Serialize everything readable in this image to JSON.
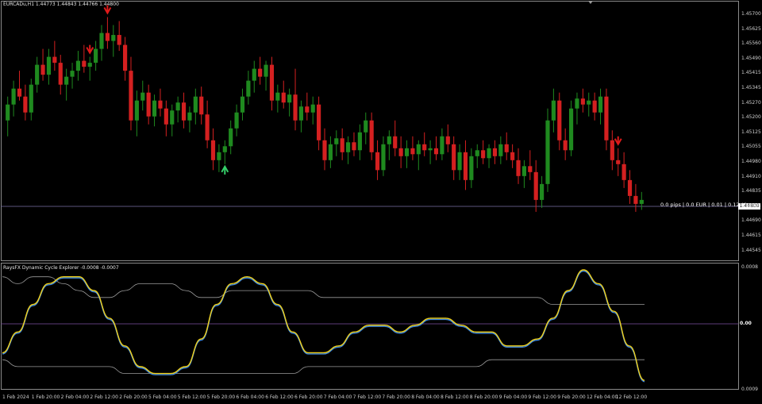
{
  "header": {
    "symbol_title": "EURCADu,H1  1.44773 1.44843 1.44766 1.44800",
    "indicator_title": "RaysFX Dynamic Cycle Explorer -0.0008 -0.0007"
  },
  "overlay": {
    "pips_label": "0.0 pips | 0.0 EUR | 0.01 | 0.12 / |",
    "current_price": "1.44800",
    "indicator_zero": "0.00"
  },
  "price_axis": [
    "1.45700",
    "1.45625",
    "1.45560",
    "1.45490",
    "1.45415",
    "1.45345",
    "1.45270",
    "1.45200",
    "1.45125",
    "1.45055",
    "1.44980",
    "1.44910",
    "1.44835",
    "1.44765",
    "1.44690",
    "1.44615",
    "1.44545"
  ],
  "indicator_axis": [
    "0.0008",
    "0.00",
    "0.0009"
  ],
  "time_axis": [
    "1 Feb 2024",
    "1 Feb 20:00",
    "2 Feb 04:00",
    "2 Feb 12:00",
    "2 Feb 20:00",
    "5 Feb 04:00",
    "5 Feb 12:00",
    "5 Feb 20:00",
    "6 Feb 04:00",
    "6 Feb 12:00",
    "6 Feb 20:00",
    "7 Feb 04:00",
    "7 Feb 12:00",
    "7 Feb 20:00",
    "8 Feb 04:00",
    "8 Feb 12:00",
    "8 Feb 20:00",
    "9 Feb 04:00",
    "9 Feb 12:00",
    "9 Feb 20:00",
    "12 Feb 04:00",
    "12 Feb 12:00"
  ],
  "colors": {
    "bull": "#1f8a1f",
    "bear": "#d42020",
    "signal_down": "#e01a1a",
    "signal_up": "#35d06a",
    "cycle_fast": "#f2d21b",
    "cycle_slow": "#3a86e0",
    "bands": "#9a9a9a",
    "zero_line": "#7a4fa0",
    "price_line": "#7b6fa8"
  },
  "chart_data": {
    "type": "candlestick",
    "symbol": "EURCADu",
    "timeframe": "H1",
    "last_price": 1.448,
    "y_range": [
      1.4452,
      1.4575
    ],
    "candles": [
      [
        1.452,
        1.4532,
        1.4512,
        1.4528
      ],
      [
        1.4528,
        1.454,
        1.4522,
        1.4536
      ],
      [
        1.4536,
        1.4545,
        1.453,
        1.4532
      ],
      [
        1.4532,
        1.4538,
        1.452,
        1.4524
      ],
      [
        1.4524,
        1.4541,
        1.452,
        1.4538
      ],
      [
        1.4538,
        1.4552,
        1.4534,
        1.4548
      ],
      [
        1.4548,
        1.4556,
        1.454,
        1.4543
      ],
      [
        1.4543,
        1.4556,
        1.4538,
        1.4552
      ],
      [
        1.4552,
        1.456,
        1.4545,
        1.4549
      ],
      [
        1.4549,
        1.4553,
        1.4533,
        1.4538
      ],
      [
        1.4538,
        1.4546,
        1.453,
        1.4542
      ],
      [
        1.4542,
        1.4549,
        1.4536,
        1.4545
      ],
      [
        1.4545,
        1.4555,
        1.454,
        1.455
      ],
      [
        1.455,
        1.4558,
        1.4544,
        1.4547
      ],
      [
        1.4547,
        1.4552,
        1.454,
        1.4549
      ],
      [
        1.4549,
        1.456,
        1.4545,
        1.4556
      ],
      [
        1.4556,
        1.4568,
        1.455,
        1.4564
      ],
      [
        1.4564,
        1.4572,
        1.4556,
        1.456
      ],
      [
        1.456,
        1.4568,
        1.4552,
        1.4563
      ],
      [
        1.4563,
        1.457,
        1.4555,
        1.4558
      ],
      [
        1.4558,
        1.4562,
        1.454,
        1.4545
      ],
      [
        1.4545,
        1.4552,
        1.4515,
        1.452
      ],
      [
        1.452,
        1.4535,
        1.4512,
        1.453
      ],
      [
        1.453,
        1.454,
        1.4525,
        1.4534
      ],
      [
        1.4534,
        1.4538,
        1.4518,
        1.4522
      ],
      [
        1.4522,
        1.4533,
        1.4517,
        1.453
      ],
      [
        1.453,
        1.4536,
        1.4522,
        1.4526
      ],
      [
        1.4526,
        1.453,
        1.4512,
        1.4518
      ],
      [
        1.4518,
        1.4528,
        1.4512,
        1.4525
      ],
      [
        1.4525,
        1.4532,
        1.4519,
        1.4529
      ],
      [
        1.4529,
        1.4534,
        1.4516,
        1.452
      ],
      [
        1.452,
        1.4527,
        1.4514,
        1.4524
      ],
      [
        1.4524,
        1.4536,
        1.4518,
        1.4532
      ],
      [
        1.4532,
        1.4537,
        1.4518,
        1.4523
      ],
      [
        1.4523,
        1.453,
        1.4506,
        1.451
      ],
      [
        1.451,
        1.4516,
        1.4495,
        1.45
      ],
      [
        1.45,
        1.4508,
        1.4494,
        1.4504
      ],
      [
        1.4504,
        1.451,
        1.4498,
        1.4507
      ],
      [
        1.4507,
        1.452,
        1.4503,
        1.4516
      ],
      [
        1.4516,
        1.4528,
        1.4512,
        1.4524
      ],
      [
        1.4524,
        1.4536,
        1.452,
        1.4532
      ],
      [
        1.4532,
        1.4545,
        1.4528,
        1.454
      ],
      [
        1.454,
        1.455,
        1.4534,
        1.4546
      ],
      [
        1.4546,
        1.4552,
        1.4538,
        1.4542
      ],
      [
        1.4542,
        1.455,
        1.4535,
        1.4548
      ],
      [
        1.4548,
        1.4552,
        1.4525,
        1.453
      ],
      [
        1.453,
        1.4538,
        1.4524,
        1.4534
      ],
      [
        1.4534,
        1.454,
        1.4526,
        1.4529
      ],
      [
        1.4529,
        1.4536,
        1.4522,
        1.4533
      ],
      [
        1.4533,
        1.4546,
        1.4515,
        1.452
      ],
      [
        1.452,
        1.453,
        1.4514,
        1.4527
      ],
      [
        1.4527,
        1.4534,
        1.452,
        1.4524
      ],
      [
        1.4524,
        1.4532,
        1.4518,
        1.4528
      ],
      [
        1.4528,
        1.4532,
        1.4505,
        1.451
      ],
      [
        1.451,
        1.4516,
        1.4495,
        1.45
      ],
      [
        1.45,
        1.4512,
        1.4496,
        1.4508
      ],
      [
        1.4508,
        1.4515,
        1.4502,
        1.4511
      ],
      [
        1.4511,
        1.4516,
        1.45,
        1.4504
      ],
      [
        1.4504,
        1.4512,
        1.4498,
        1.4509
      ],
      [
        1.4509,
        1.4514,
        1.4502,
        1.4505
      ],
      [
        1.4505,
        1.4518,
        1.45,
        1.4514
      ],
      [
        1.4514,
        1.4524,
        1.4508,
        1.452
      ],
      [
        1.452,
        1.4524,
        1.45,
        1.4504
      ],
      [
        1.4504,
        1.451,
        1.449,
        1.4495
      ],
      [
        1.4495,
        1.4512,
        1.4492,
        1.4508
      ],
      [
        1.4508,
        1.4515,
        1.45,
        1.4512
      ],
      [
        1.4512,
        1.452,
        1.4502,
        1.4506
      ],
      [
        1.4506,
        1.4512,
        1.4496,
        1.4502
      ],
      [
        1.4502,
        1.451,
        1.4496,
        1.4506
      ],
      [
        1.4506,
        1.4512,
        1.45,
        1.4503
      ],
      [
        1.4503,
        1.451,
        1.4495,
        1.4508
      ],
      [
        1.4508,
        1.4514,
        1.4502,
        1.4505
      ],
      [
        1.4505,
        1.451,
        1.4498,
        1.4506
      ],
      [
        1.4506,
        1.4512,
        1.45,
        1.4503
      ],
      [
        1.4503,
        1.4516,
        1.45,
        1.4512
      ],
      [
        1.4512,
        1.4518,
        1.4504,
        1.4508
      ],
      [
        1.4508,
        1.4512,
        1.449,
        1.4495
      ],
      [
        1.4495,
        1.4508,
        1.449,
        1.4504
      ],
      [
        1.4504,
        1.451,
        1.4485,
        1.449
      ],
      [
        1.449,
        1.4506,
        1.4486,
        1.4502
      ],
      [
        1.4502,
        1.4508,
        1.4496,
        1.4505
      ],
      [
        1.4505,
        1.451,
        1.4498,
        1.4501
      ],
      [
        1.4501,
        1.4508,
        1.4496,
        1.4506
      ],
      [
        1.4506,
        1.451,
        1.4498,
        1.4502
      ],
      [
        1.4502,
        1.4512,
        1.4498,
        1.4508
      ],
      [
        1.4508,
        1.4514,
        1.45,
        1.4504
      ],
      [
        1.4504,
        1.4508,
        1.4496,
        1.45
      ],
      [
        1.45,
        1.4506,
        1.4488,
        1.4492
      ],
      [
        1.4492,
        1.45,
        1.4486,
        1.4497
      ],
      [
        1.4497,
        1.4505,
        1.449,
        1.4494
      ],
      [
        1.4494,
        1.45,
        1.4474,
        1.448
      ],
      [
        1.448,
        1.4492,
        1.4476,
        1.4488
      ],
      [
        1.4488,
        1.4526,
        1.4484,
        1.452
      ],
      [
        1.452,
        1.4536,
        1.4514,
        1.453
      ],
      [
        1.453,
        1.4534,
        1.4505,
        1.451
      ],
      [
        1.451,
        1.4516,
        1.45,
        1.4505
      ],
      [
        1.4505,
        1.453,
        1.4502,
        1.4526
      ],
      [
        1.4526,
        1.4534,
        1.4518,
        1.4531
      ],
      [
        1.4531,
        1.4536,
        1.4524,
        1.4528
      ],
      [
        1.4528,
        1.4534,
        1.4522,
        1.453
      ],
      [
        1.453,
        1.4534,
        1.452,
        1.4524
      ],
      [
        1.4524,
        1.4536,
        1.4518,
        1.4532
      ],
      [
        1.4532,
        1.4536,
        1.4505,
        1.451
      ],
      [
        1.451,
        1.4515,
        1.4495,
        1.45
      ],
      [
        1.45,
        1.4506,
        1.4492,
        1.4498
      ],
      [
        1.4498,
        1.4504,
        1.4486,
        1.449
      ],
      [
        1.449,
        1.4495,
        1.4478,
        1.4482
      ],
      [
        1.4482,
        1.4488,
        1.4474,
        1.4478
      ],
      [
        1.4478,
        1.4484,
        1.4475,
        1.448
      ]
    ],
    "signal_arrows": [
      {
        "bar": 17,
        "direction": "down"
      },
      {
        "bar": 14,
        "direction": "down"
      },
      {
        "bar": 37,
        "direction": "up"
      },
      {
        "bar": 104,
        "direction": "down"
      }
    ],
    "indicator": {
      "name": "RaysFX Dynamic Cycle Explorer",
      "values": [
        -0.0008,
        -0.0007
      ],
      "y_range": [
        -0.0009,
        0.0008
      ],
      "cycle_series": [
        -0.0004,
        -0.0001,
        0.0003,
        0.0006,
        0.0007,
        0.0007,
        0.0005,
        0.0001,
        -0.0003,
        -0.0006,
        -0.0007,
        -0.0007,
        -0.0006,
        -0.0002,
        0.0003,
        0.0006,
        0.0007,
        0.0006,
        0.0003,
        -0.0001,
        -0.0004,
        -0.0004,
        -0.0003,
        -0.0001,
        0.0,
        0.0,
        -0.0001,
        0.0,
        0.0001,
        0.0001,
        0.0,
        -0.0001,
        -0.0001,
        -0.0003,
        -0.0003,
        -0.0002,
        0.0001,
        0.0005,
        0.0008,
        0.0006,
        0.0002,
        -0.0003,
        -0.0008
      ],
      "upper_band": [
        0.0007,
        0.0006,
        0.0007,
        0.0007,
        0.0006,
        0.0005,
        0.0004,
        0.0004,
        0.0005,
        0.0006,
        0.0006,
        0.0006,
        0.0005,
        0.0004,
        0.0004,
        0.0005,
        0.0005,
        0.0005,
        0.0005,
        0.0005,
        0.0005,
        0.0004,
        0.0004,
        0.0004,
        0.0004,
        0.0004,
        0.0004,
        0.0004,
        0.0004,
        0.0004,
        0.0004,
        0.0004,
        0.0004,
        0.0004,
        0.0004,
        0.0004,
        0.0003,
        0.0003,
        0.0003,
        0.0003,
        0.0003,
        0.0003,
        0.0003
      ],
      "lower_band": [
        -0.0005,
        -0.0006,
        -0.0006,
        -0.0006,
        -0.0006,
        -0.0006,
        -0.0006,
        -0.0006,
        -0.0007,
        -0.0007,
        -0.0007,
        -0.0007,
        -0.0007,
        -0.0007,
        -0.0007,
        -0.0007,
        -0.0007,
        -0.0007,
        -0.0007,
        -0.0007,
        -0.0006,
        -0.0006,
        -0.0006,
        -0.0006,
        -0.0006,
        -0.0006,
        -0.0006,
        -0.0006,
        -0.0006,
        -0.0006,
        -0.0006,
        -0.0006,
        -0.0005,
        -0.0005,
        -0.0005,
        -0.0005,
        -0.0005,
        -0.0005,
        -0.0005,
        -0.0005,
        -0.0005,
        -0.0005,
        -0.0005
      ]
    }
  }
}
